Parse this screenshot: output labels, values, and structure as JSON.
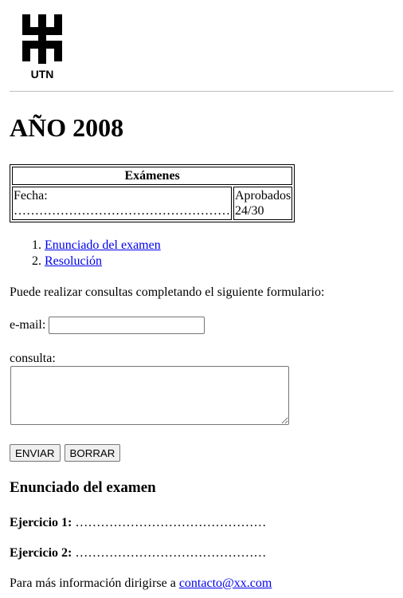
{
  "logo": {
    "text": "UTN"
  },
  "heading": "AÑO 2008",
  "exams_table": {
    "caption": "Exámenes",
    "fecha_label": "Fecha:",
    "fecha_value": "……………………………………………",
    "aprobados_label": "Aprobados",
    "aprobados_value": "24/30"
  },
  "links": [
    {
      "label": "Enunciado del examen"
    },
    {
      "label": "Resolución"
    }
  ],
  "consult_text": "Puede realizar consultas completando el siguiente formulario:",
  "form": {
    "email_label": "e-mail:",
    "email_value": "",
    "consulta_label": "consulta:",
    "consulta_value": "",
    "submit_label": "ENVIAR",
    "reset_label": "BORRAR"
  },
  "section_title": "Enunciado del examen",
  "ejercicios": [
    {
      "label": "Ejercicio 1:",
      "value": "………………………………………"
    },
    {
      "label": "Ejercicio 2:",
      "value": "………………………………………"
    }
  ],
  "footer": {
    "text": "Para más información dirigirse a ",
    "link": "contacto@xx.com"
  }
}
